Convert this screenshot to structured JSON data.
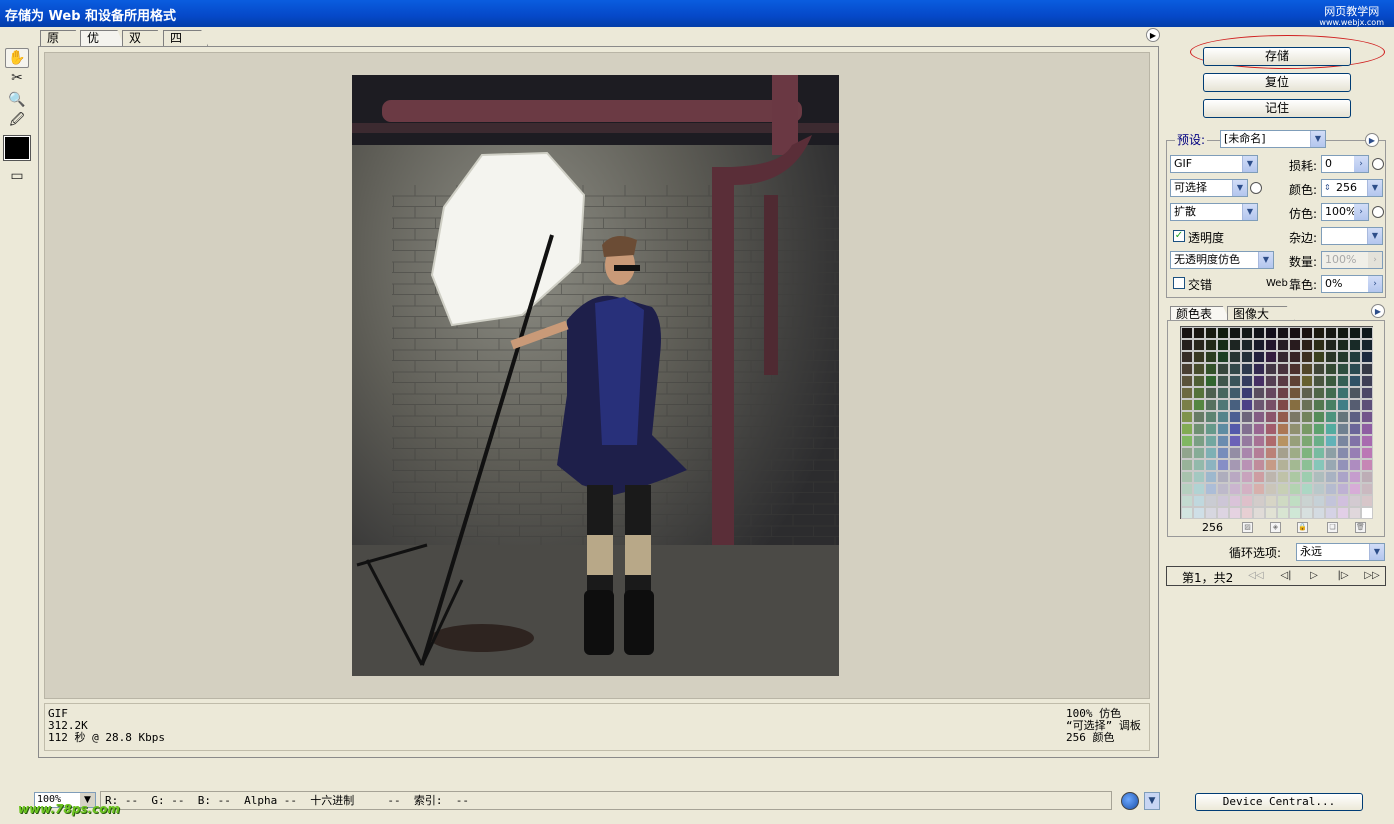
{
  "window": {
    "title": "存储为 Web 和设备所用格式",
    "watermark_top_line1": "网页教学网",
    "watermark_top_line2": "www.webjx.com",
    "watermark_bottom": "www.78ps.com"
  },
  "tabs": [
    "原稿",
    "优化",
    "双联",
    "四联"
  ],
  "active_tab": "优化",
  "tools": [
    "hand-icon",
    "slice-select-icon",
    "zoom-icon",
    "eyedropper-icon",
    "eyedropper-color-swatch",
    "toggle-slices-icon"
  ],
  "eyedropper_color": "#000000",
  "image_info": {
    "format": "GIF",
    "size": "312.2K",
    "download_time": "112 秒 @ 28.8 Kbps",
    "dither_info": "100% 仿色",
    "palette_info": "“可选择” 调板",
    "colors_info": "256 颜色"
  },
  "buttons": {
    "save": "存储",
    "reset": "复位",
    "remember": "记住",
    "device_central": "Device Central..."
  },
  "settings": {
    "preset_label": "预设:",
    "preset_value": "[未命名]",
    "format_value": "GIF",
    "reduction_value": "可选择",
    "dither_algo_value": "扩散",
    "transparency_label": "透明度",
    "transparency_checked": true,
    "trans_dither_value": "无透明度仿色",
    "interlaced_label": "交错",
    "interlaced_checked": false,
    "lossy_label": "损耗:",
    "lossy_value": "0",
    "colors_label": "颜色:",
    "colors_value": "256",
    "dither_label": "仿色:",
    "dither_value": "100%",
    "matte_label": "杂边:",
    "matte_value": "",
    "amount_label": "数量:",
    "amount_value": "100%",
    "websnap_label_prefix": "Web",
    "websnap_label": "靠色:",
    "websnap_value": "0%"
  },
  "color_table": {
    "tabs": [
      "颜色表",
      "图像大小"
    ],
    "active_tab": "颜色表",
    "count": "256"
  },
  "animation": {
    "loop_label": "循环选项:",
    "loop_value": "永远",
    "frame_label": "第1，共2"
  },
  "status": {
    "zoom_value": "100%",
    "readout": "R: --  G: --  B: --  Alpha --  十六进制     --  索引:  --"
  },
  "colors": {
    "titlebar": "#0548c8",
    "window_bg": "#ece9d8",
    "canvas_bg": "#d4d0c1",
    "highlight_ellipse": "#d02020"
  }
}
